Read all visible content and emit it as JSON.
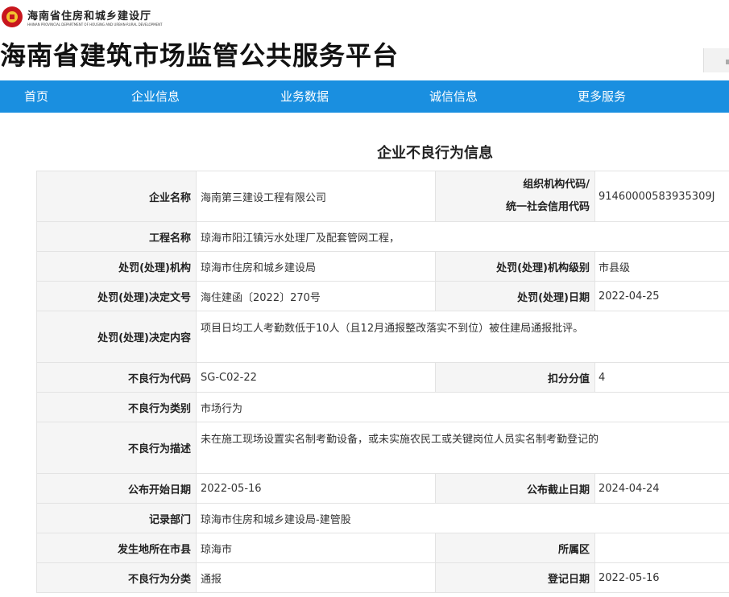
{
  "header": {
    "dept_cn": "海南省住房和城乡建设厅",
    "dept_en": "HAINAN PROVINCIAL DEPARTMENT OF HOUSING AND URBAN-RURAL DEVELOPMENT",
    "site_title": "海南省建筑市场监管公共服务平台"
  },
  "nav": [
    "首页",
    "企业信息",
    "业务数据",
    "诚信信息",
    "更多服务"
  ],
  "page_heading": "企业不良行为信息",
  "record": {
    "company_label": "企业名称",
    "company": "海南第三建设工程有限公司",
    "org_code_label_1": "组织机构代码/",
    "org_code_label_2": "统一社会信用代码",
    "org_code": "91460000583935309J",
    "project_label": "工程名称",
    "project": "琼海市阳江镇污水处理厂及配套管网工程，",
    "authority_label": "处罚(处理)机构",
    "authority": "琼海市住房和城乡建设局",
    "authority_level_label": "处罚(处理)机构级别",
    "authority_level": "市县级",
    "doc_no_label": "处罚(处理)决定文号",
    "doc_no": "海住建函〔2022〕270号",
    "date_label": "处罚(处理)日期",
    "date": "2022-04-25",
    "decision_label": "处罚(处理)决定内容",
    "decision": "项目日均工人考勤数低于10人（且12月通报整改落实不到位）被住建局通报批评。",
    "behavior_code_label": "不良行为代码",
    "behavior_code": "SG-C02-22",
    "score_label": "扣分分值",
    "score": "4",
    "category_label": "不良行为类别",
    "category": "市场行为",
    "description_label": "不良行为描述",
    "description": "未在施工现场设置实名制考勤设备，或未实施农民工或关键岗位人员实名制考勤登记的",
    "publish_start_label": "公布开始日期",
    "publish_start": "2022-05-16",
    "publish_end_label": "公布截止日期",
    "publish_end": "2024-04-24",
    "record_dept_label": "记录部门",
    "record_dept": "琼海市住房和城乡建设局-建管股",
    "city_label": "发生地所在市县",
    "city": "琼海市",
    "district_label": "所属区",
    "district": "",
    "classification_label": "不良行为分类",
    "classification": "通报",
    "register_date_label": "登记日期",
    "register_date": "2022-05-16"
  }
}
